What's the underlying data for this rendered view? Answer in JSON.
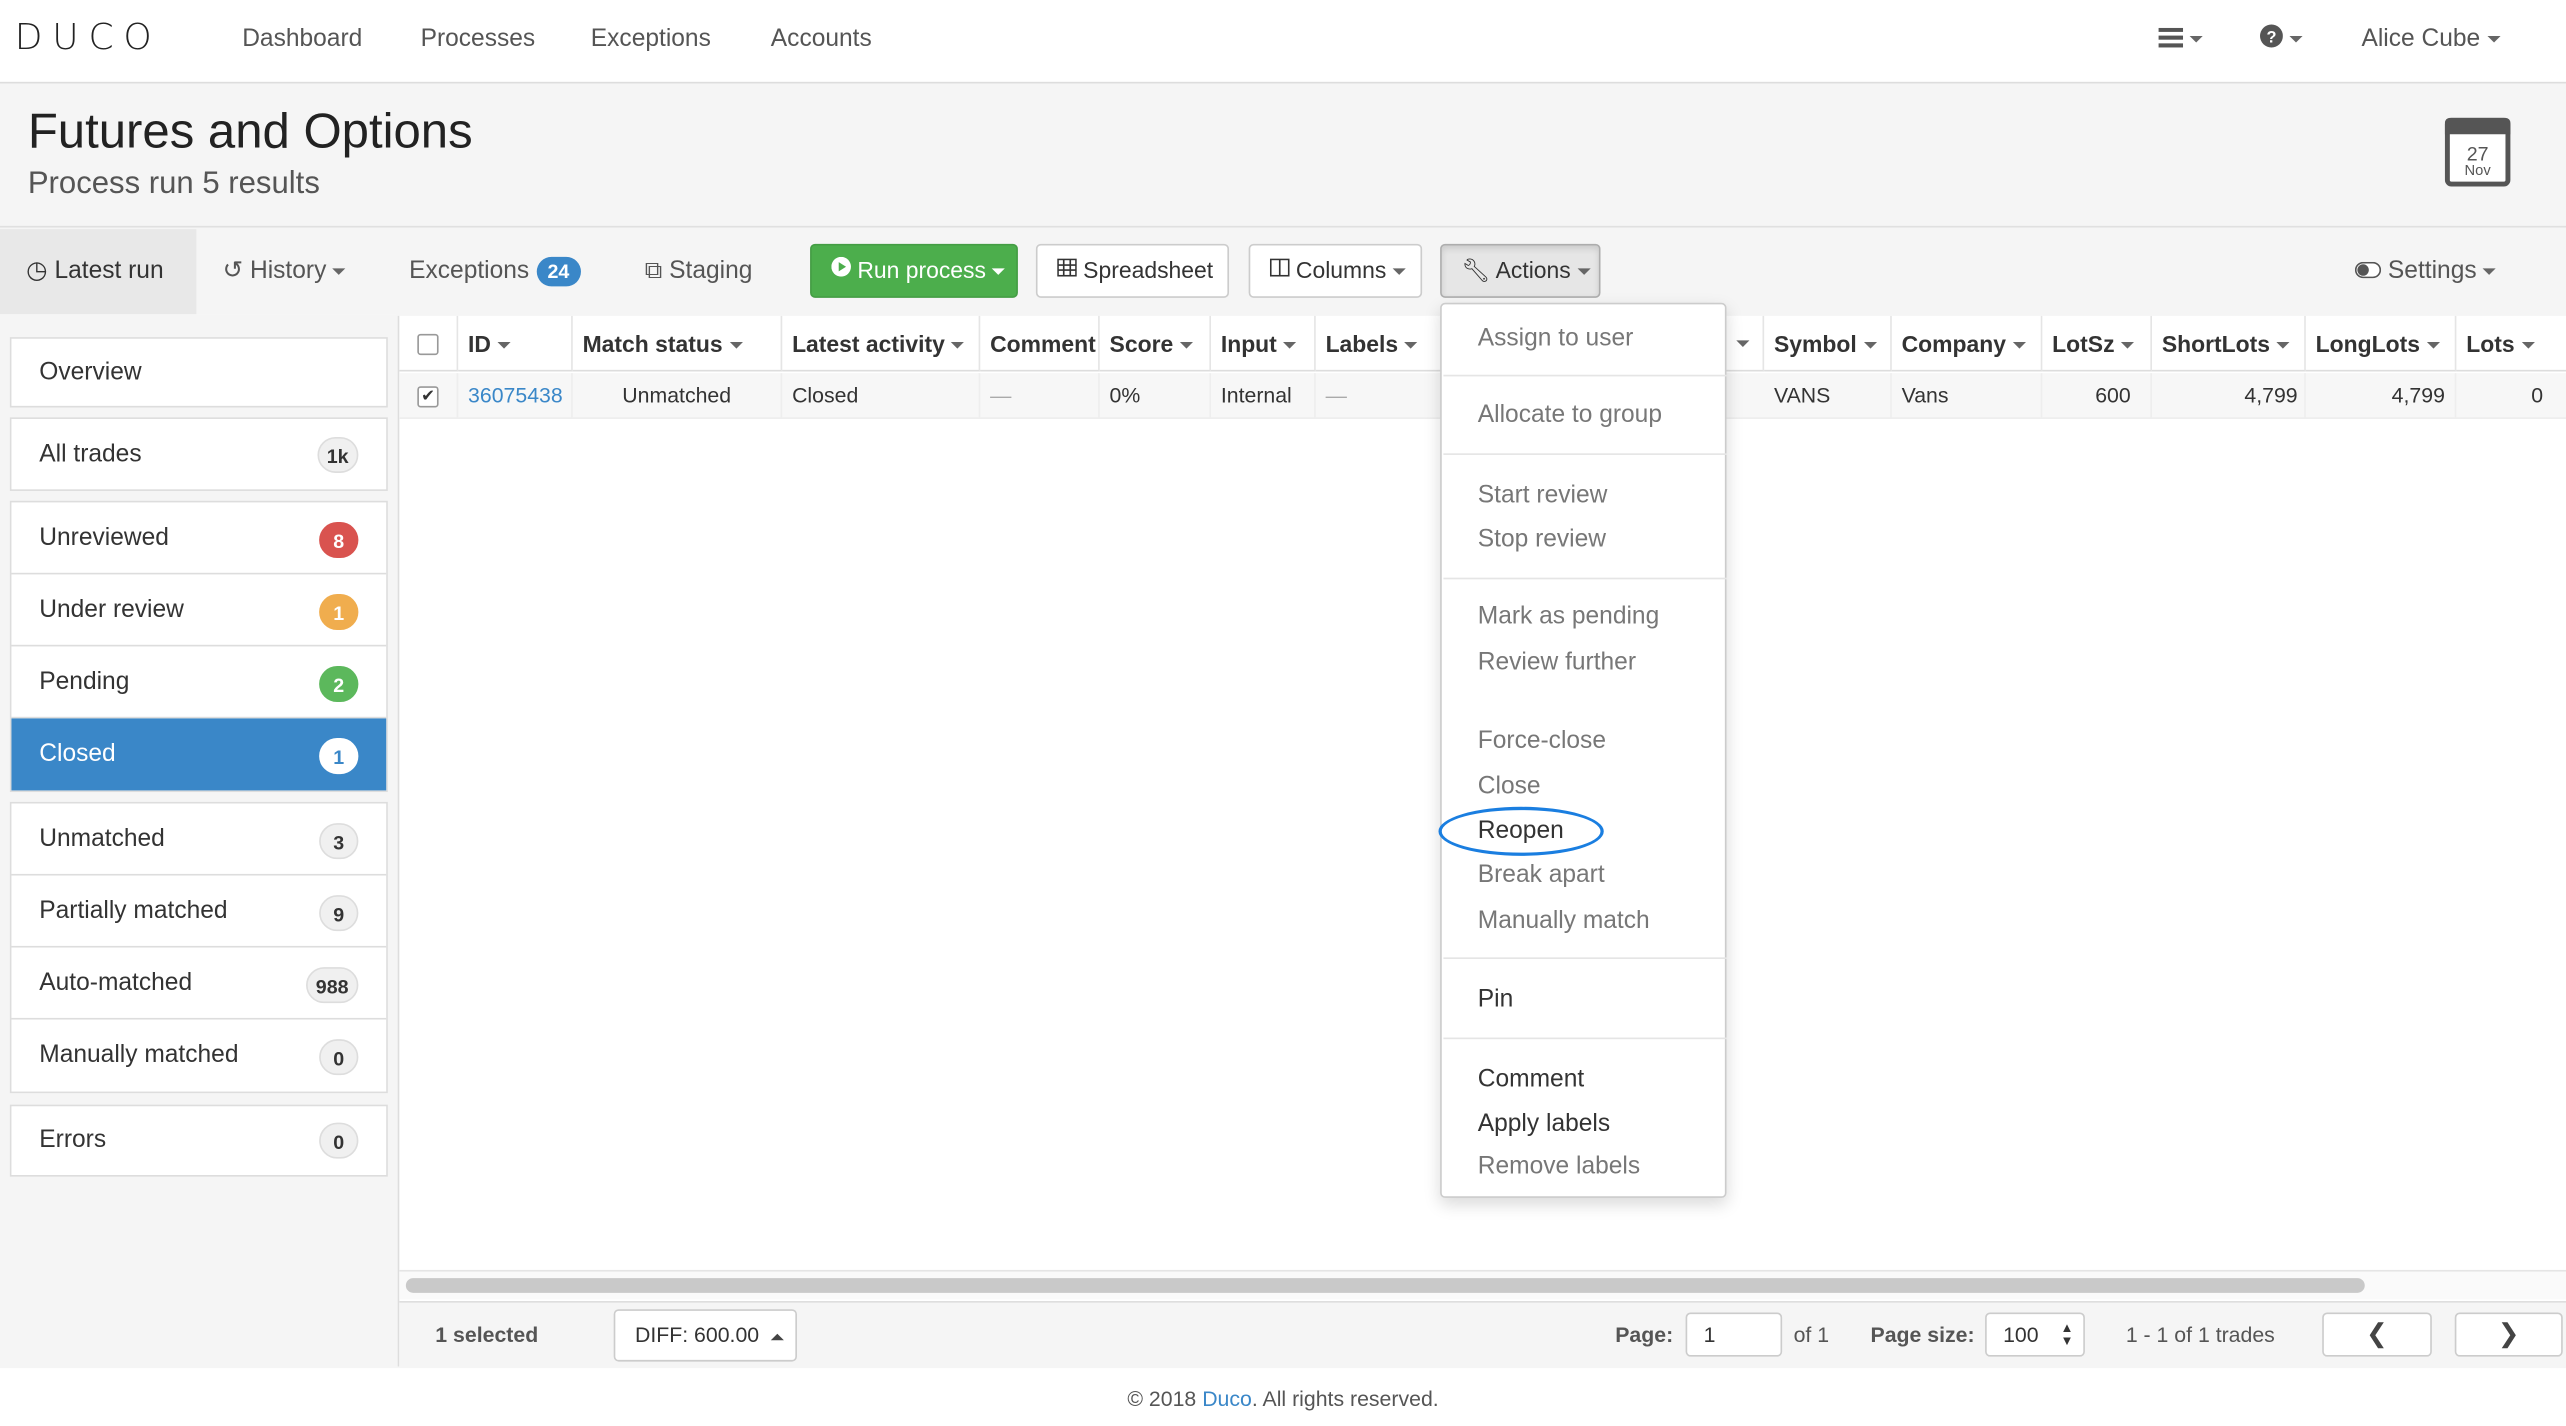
{
  "nav": {
    "logo": "DUCO",
    "links": [
      "Dashboard",
      "Processes",
      "Exceptions",
      "Accounts"
    ],
    "user": "Alice Cube"
  },
  "header": {
    "title": "Futures and Options",
    "subtitle": "Process run 5 results",
    "calendar_day": "27",
    "calendar_month": "Nov"
  },
  "toolbar": {
    "latest_run": "Latest run",
    "history": "History",
    "exceptions": "Exceptions",
    "exceptions_count": "24",
    "staging": "Staging",
    "run_process": "Run process",
    "spreadsheet": "Spreadsheet",
    "columns": "Columns",
    "actions": "Actions",
    "settings": "Settings"
  },
  "sidebar": {
    "overview": "Overview",
    "all_trades": {
      "label": "All trades",
      "count": "1k"
    },
    "unreviewed": {
      "label": "Unreviewed",
      "count": "8"
    },
    "under_review": {
      "label": "Under review",
      "count": "1"
    },
    "pending": {
      "label": "Pending",
      "count": "2"
    },
    "closed": {
      "label": "Closed",
      "count": "1"
    },
    "unmatched": {
      "label": "Unmatched",
      "count": "3"
    },
    "partially_matched": {
      "label": "Partially matched",
      "count": "9"
    },
    "auto_matched": {
      "label": "Auto-matched",
      "count": "988"
    },
    "manually_matched": {
      "label": "Manually matched",
      "count": "0"
    },
    "errors": {
      "label": "Errors",
      "count": "0"
    }
  },
  "table": {
    "headers": {
      "id": "ID",
      "match_status": "Match status",
      "latest_activity": "Latest activity",
      "comment": "Comment",
      "score": "Score",
      "input": "Input",
      "labels": "Labels",
      "symbol": "Symbol",
      "company": "Company",
      "lotsz": "LotSz",
      "shortlots": "ShortLots",
      "longlots": "LongLots",
      "lots": "Lots"
    },
    "row": {
      "id": "36075438",
      "match_status": "Unmatched",
      "latest_activity": "Closed",
      "comment": "—",
      "score": "0%",
      "input": "Internal",
      "labels": "—",
      "symbol": "VANS",
      "company": "Vans",
      "lotsz": "600",
      "shortlots": "4,799",
      "longlots": "4,799",
      "lots": "0"
    }
  },
  "footer_bar": {
    "selected": "1 selected",
    "diff": "DIFF: 600.00",
    "page_label": "Page:",
    "page_value": "1",
    "of": "of 1",
    "page_size_label": "Page size:",
    "page_size_value": "100",
    "range": "1 - 1 of 1 trades"
  },
  "actions_menu": {
    "assign_to_user": "Assign to user",
    "allocate_to_group": "Allocate to group",
    "start_review": "Start review",
    "stop_review": "Stop review",
    "mark_as_pending": "Mark as pending",
    "review_further": "Review further",
    "force_close": "Force-close",
    "close": "Close",
    "reopen": "Reopen",
    "break_apart": "Break apart",
    "manually_match": "Manually match",
    "pin": "Pin",
    "comment": "Comment",
    "apply_labels": "Apply labels",
    "remove_labels": "Remove labels"
  },
  "page_footer": {
    "prefix": "© 2018 ",
    "link": "Duco",
    "suffix": ". All rights reserved."
  }
}
